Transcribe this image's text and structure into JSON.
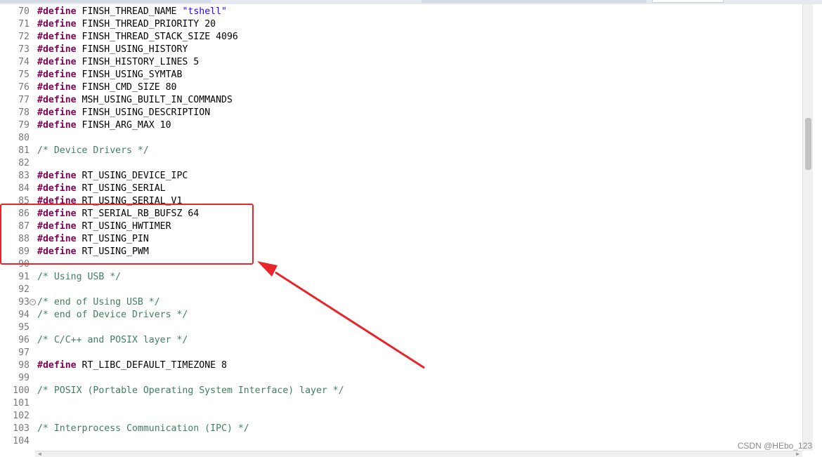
{
  "editor": {
    "lines": [
      {
        "n": "70",
        "parts": [
          [
            "kw",
            "#define"
          ],
          [
            "t",
            " FINSH_THREAD_NAME "
          ],
          [
            "str",
            "\"tshell\""
          ]
        ]
      },
      {
        "n": "71",
        "parts": [
          [
            "kw",
            "#define"
          ],
          [
            "t",
            " FINSH_THREAD_PRIORITY 20"
          ]
        ]
      },
      {
        "n": "72",
        "parts": [
          [
            "kw",
            "#define"
          ],
          [
            "t",
            " FINSH_THREAD_STACK_SIZE 4096"
          ]
        ]
      },
      {
        "n": "73",
        "parts": [
          [
            "kw",
            "#define"
          ],
          [
            "t",
            " FINSH_USING_HISTORY"
          ]
        ]
      },
      {
        "n": "74",
        "parts": [
          [
            "kw",
            "#define"
          ],
          [
            "t",
            " FINSH_HISTORY_LINES 5"
          ]
        ]
      },
      {
        "n": "75",
        "parts": [
          [
            "kw",
            "#define"
          ],
          [
            "t",
            " FINSH_USING_SYMTAB"
          ]
        ]
      },
      {
        "n": "76",
        "parts": [
          [
            "kw",
            "#define"
          ],
          [
            "t",
            " FINSH_CMD_SIZE 80"
          ]
        ]
      },
      {
        "n": "77",
        "parts": [
          [
            "kw",
            "#define"
          ],
          [
            "t",
            " MSH_USING_BUILT_IN_COMMANDS"
          ]
        ]
      },
      {
        "n": "78",
        "parts": [
          [
            "kw",
            "#define"
          ],
          [
            "t",
            " FINSH_USING_DESCRIPTION"
          ]
        ]
      },
      {
        "n": "79",
        "parts": [
          [
            "kw",
            "#define"
          ],
          [
            "t",
            " FINSH_ARG_MAX 10"
          ]
        ]
      },
      {
        "n": "80",
        "parts": []
      },
      {
        "n": "81",
        "parts": [
          [
            "cm",
            "/* Device Drivers */"
          ]
        ]
      },
      {
        "n": "82",
        "parts": []
      },
      {
        "n": "83",
        "parts": [
          [
            "kw",
            "#define"
          ],
          [
            "t",
            " RT_USING_DEVICE_IPC"
          ]
        ]
      },
      {
        "n": "84",
        "parts": [
          [
            "kw",
            "#define"
          ],
          [
            "t",
            " RT_USING_SERIAL"
          ]
        ]
      },
      {
        "n": "85",
        "parts": [
          [
            "kw",
            "#define"
          ],
          [
            "t",
            " RT_USING_SERIAL_V1"
          ]
        ]
      },
      {
        "n": "86",
        "parts": [
          [
            "kw",
            "#define"
          ],
          [
            "t",
            " RT_SERIAL_RB_BUFSZ 64"
          ]
        ]
      },
      {
        "n": "87",
        "parts": [
          [
            "kw",
            "#define"
          ],
          [
            "t",
            " RT_USING_HWTIMER"
          ]
        ]
      },
      {
        "n": "88",
        "parts": [
          [
            "kw",
            "#define"
          ],
          [
            "t",
            " RT_USING_PIN"
          ]
        ]
      },
      {
        "n": "89",
        "parts": [
          [
            "kw",
            "#define"
          ],
          [
            "t",
            " RT_USING_PWM"
          ]
        ]
      },
      {
        "n": "90",
        "parts": []
      },
      {
        "n": "91",
        "parts": [
          [
            "cm",
            "/* Using USB */"
          ]
        ]
      },
      {
        "n": "92",
        "parts": []
      },
      {
        "n": "93",
        "fold": "minus",
        "parts": [
          [
            "cm",
            "/* end of Using USB */"
          ]
        ]
      },
      {
        "n": "94",
        "parts": [
          [
            "cm",
            "/* end of Device Drivers */"
          ]
        ]
      },
      {
        "n": "95",
        "parts": []
      },
      {
        "n": "96",
        "parts": [
          [
            "cm",
            "/* C/C++ and POSIX layer */"
          ]
        ]
      },
      {
        "n": "97",
        "parts": []
      },
      {
        "n": "98",
        "parts": [
          [
            "kw",
            "#define"
          ],
          [
            "t",
            " RT_LIBC_DEFAULT_TIMEZONE 8"
          ]
        ]
      },
      {
        "n": "99",
        "parts": []
      },
      {
        "n": "100",
        "parts": [
          [
            "cm",
            "/* POSIX (Portable Operating System Interface) layer */"
          ]
        ]
      },
      {
        "n": "101",
        "parts": []
      },
      {
        "n": "102",
        "parts": []
      },
      {
        "n": "103",
        "parts": [
          [
            "cm",
            "/* Interprocess Communication (IPC) */"
          ]
        ]
      },
      {
        "n": "104",
        "parts": []
      }
    ]
  },
  "fold_glyph": "⊖",
  "scroll_arrow_left": "◀",
  "scroll_arrow_right": "▶",
  "watermark": "CSDN @HEbo_123",
  "annotation_color": "#e8262a"
}
